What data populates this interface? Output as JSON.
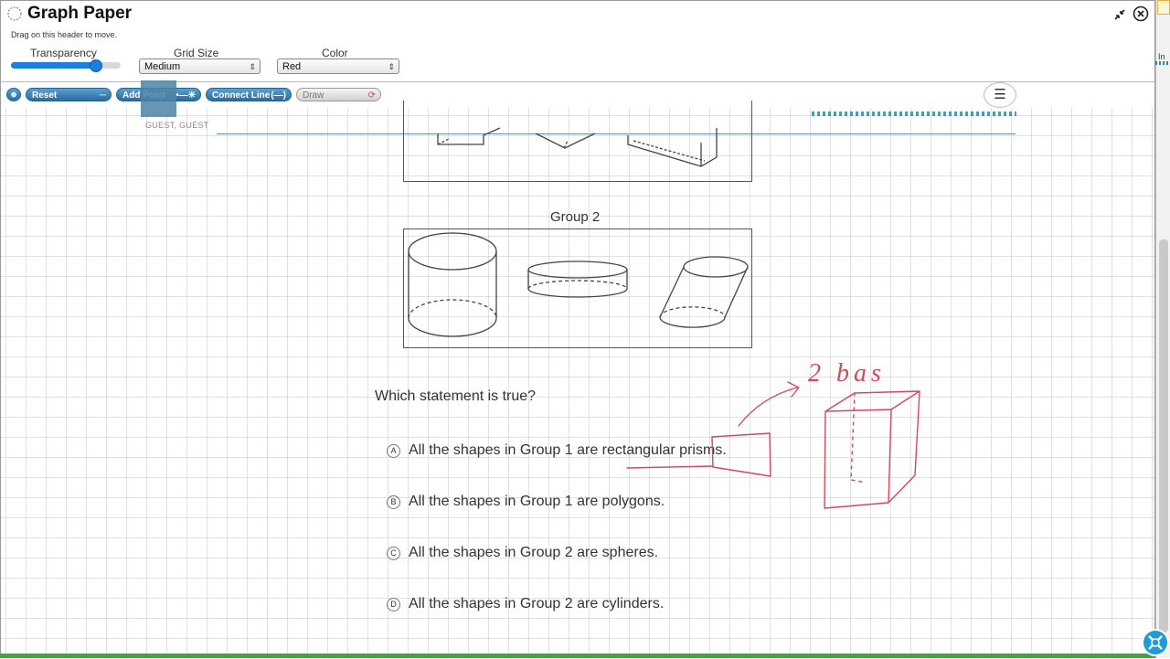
{
  "window": {
    "title": "Graph Paper",
    "drag_hint": "Drag on this header to move."
  },
  "controls": {
    "transparency_label": "Transparency",
    "transparency_value": 0.77,
    "grid_size_label": "Grid Size",
    "grid_size_value": "Medium",
    "color_label": "Color",
    "color_value": "Red"
  },
  "toolbar": {
    "reset_label": "Reset",
    "add_point_label": "Add Point",
    "connect_line_label": "Connect Line",
    "draw_label": "Draw"
  },
  "user_label": "GUEST, GUEST",
  "question": {
    "group2_title": "Group 2",
    "prompt": "Which statement is true?",
    "options": [
      {
        "letter": "A",
        "text": "All the shapes in Group 1 are rectangular prisms."
      },
      {
        "letter": "B",
        "text": "All the shapes in Group 1 are polygons."
      },
      {
        "letter": "C",
        "text": "All the shapes in Group 2 are spheres."
      },
      {
        "letter": "D",
        "text": "All the shapes in Group 2 are cylinders."
      }
    ]
  },
  "annotation": {
    "handwritten_note": "2 bas"
  },
  "side": {
    "fragment": "In"
  },
  "colors": {
    "ink": "#d4485a",
    "accent": "#1a7fe0",
    "toolbar_blue": "#2a6d9e",
    "status_green": "#3aaa3a"
  }
}
